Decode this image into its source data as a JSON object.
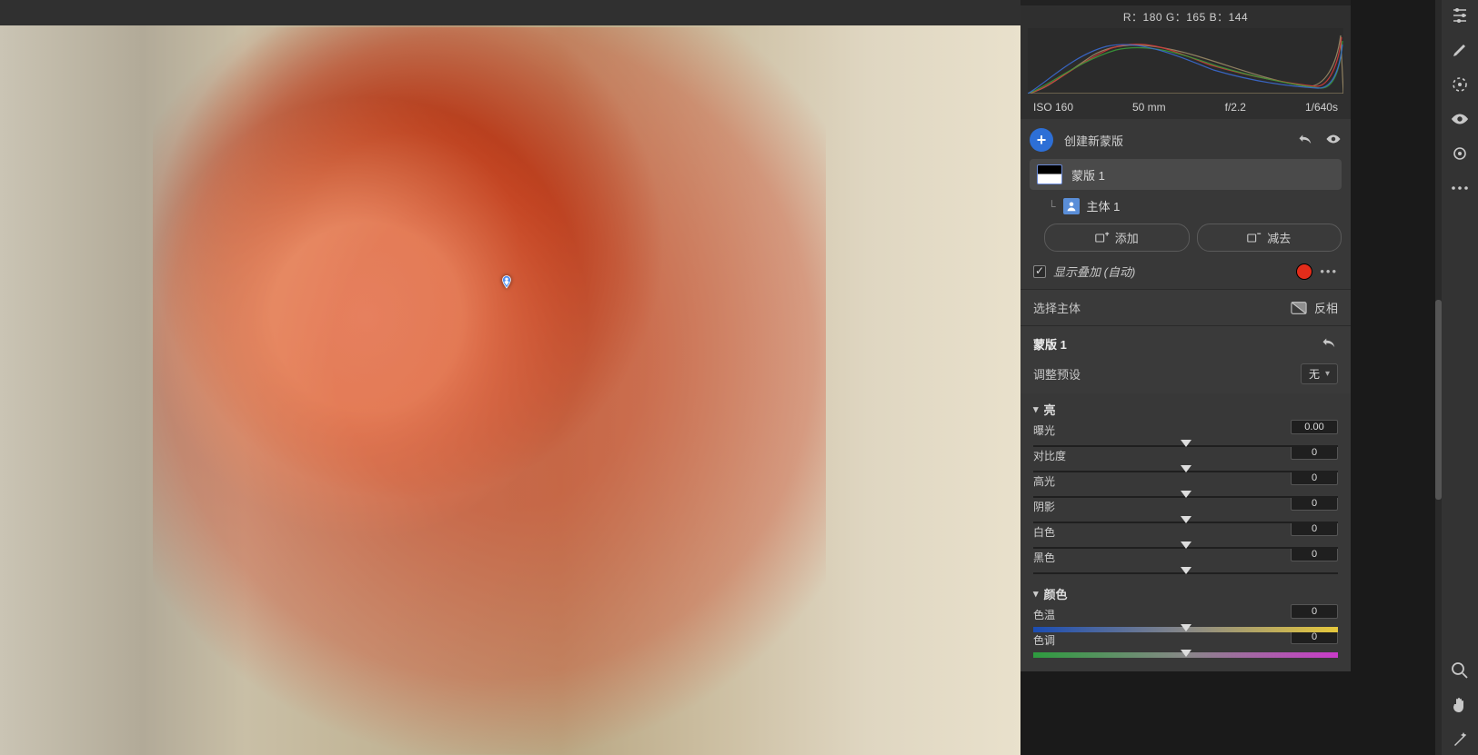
{
  "rgb": {
    "label": "R：180    G：165    B：144"
  },
  "meta": {
    "iso": "ISO  160",
    "focal": "50 mm",
    "aperture": "f/2.2",
    "shutter": "1/640s"
  },
  "mask_panel": {
    "create_label": "创建新蒙版",
    "mask_name": "蒙版 1",
    "sub_name": "主体 1",
    "add": "添加",
    "subtract": "减去"
  },
  "overlay": {
    "label": "显示叠加 (自动)",
    "checked": true,
    "color": "#e22c1a"
  },
  "select_subject": {
    "label": "选择主体",
    "invert": "反相"
  },
  "mask_settings": {
    "title": "蒙版 1",
    "preset_label": "调整预设",
    "preset_value": "无"
  },
  "light_group": {
    "title": "亮",
    "sliders": [
      {
        "label": "曝光",
        "value": "0.00"
      },
      {
        "label": "对比度",
        "value": "0"
      },
      {
        "label": "高光",
        "value": "0"
      },
      {
        "label": "阴影",
        "value": "0"
      },
      {
        "label": "白色",
        "value": "0"
      },
      {
        "label": "黑色",
        "value": "0"
      }
    ]
  },
  "color_group": {
    "title": "颜色",
    "sliders": [
      {
        "label": "色温",
        "value": "0",
        "grad": "temp"
      },
      {
        "label": "色调",
        "value": "0",
        "grad": "tint"
      }
    ]
  }
}
